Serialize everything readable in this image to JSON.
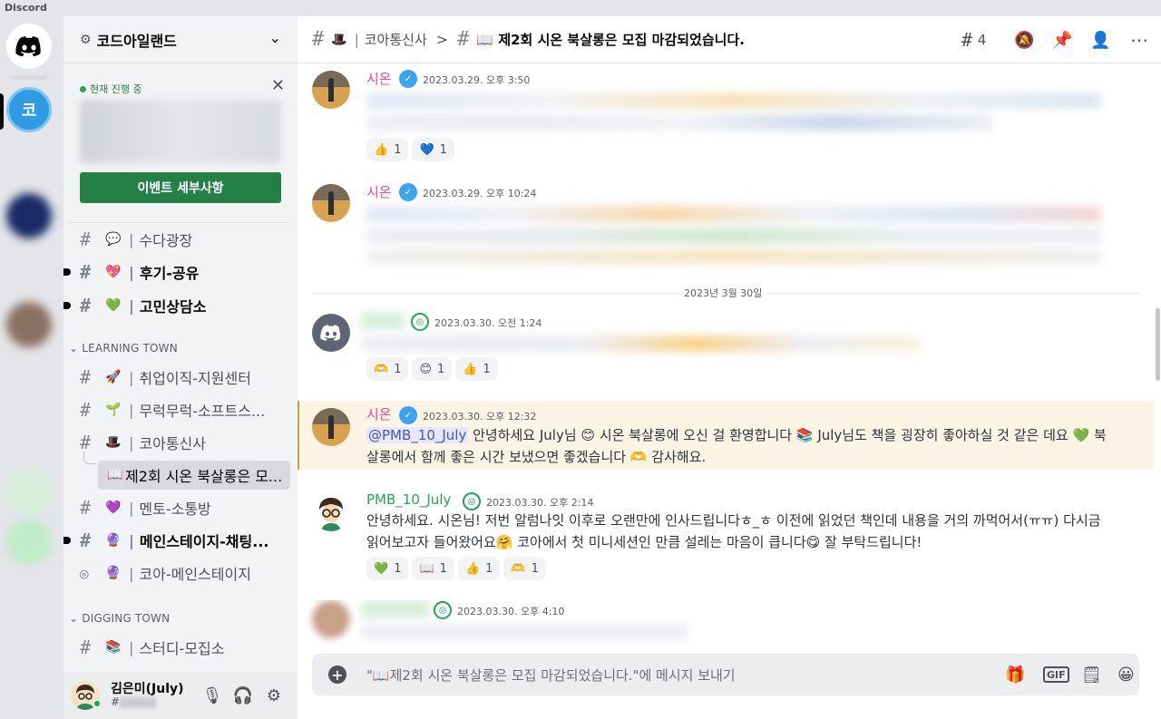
{
  "app": {
    "name": "Discord"
  },
  "server": {
    "name": "코드아일랜드"
  },
  "event": {
    "live_label": "현재 진행 중",
    "button_label": "이벤트 세부사항"
  },
  "channels": [
    {
      "emoji": "💬",
      "label": "수다광장"
    },
    {
      "emoji": "💖",
      "label": "후기-공유"
    },
    {
      "emoji": "💚",
      "label": "고민상담소"
    }
  ],
  "category_learning": "LEARNING TOWN",
  "learning": [
    {
      "emoji": "🚀",
      "label": "취업이직-지원센터"
    },
    {
      "emoji": "🌱",
      "label": "무럭무럭-소프트스..."
    },
    {
      "emoji": "🎩",
      "label": "코아통신사"
    },
    {
      "emoji": "📖",
      "label": "제2회 시온 북살롱은 모..."
    },
    {
      "emoji": "💜",
      "label": "멘토-소통방"
    },
    {
      "emoji": "🔮",
      "label": "메인스테이지-채팅..."
    },
    {
      "emoji": "🔮",
      "label": "코아-메인스테이지"
    }
  ],
  "category_digging": "DIGGING TOWN",
  "digging": [
    {
      "emoji": "📚",
      "label": "스터디-모집소"
    }
  ],
  "user": {
    "name": "김은미(July)",
    "tag": "#"
  },
  "topbar": {
    "channel": "코아통신사",
    "separator": ">",
    "thread": "📖 제2회 시온 북살롱은 모집 마감되었습니다.",
    "thread_count": "4"
  },
  "messages": [
    {
      "author": "시온",
      "timestamp": "2023.03.29. 오후 3:50",
      "reactions": [
        {
          "emoji": "👍",
          "count": "1"
        },
        {
          "emoji": "💙",
          "count": "1"
        }
      ]
    },
    {
      "author": "시온",
      "timestamp": "2023.03.29. 오후 10:24"
    },
    {
      "author": "",
      "timestamp": "2023.03.30. 오전 1:24",
      "reactions": [
        {
          "emoji": "🫶",
          "count": "1"
        },
        {
          "emoji": "😊",
          "count": "1"
        },
        {
          "emoji": "👍",
          "count": "1"
        }
      ]
    },
    {
      "author": "시온",
      "timestamp": "2023.03.30. 오후 12:32",
      "mention": "@PMB_10_July",
      "text_1": " 안녕하세요 July님 😊 시온 북살롱에 오신 걸 환영합니다 📚 July님도 책을 굉장히 좋아하실 것 같은 데요 💚 북살롱에서 함께 좋은 시간 보냈으면 좋겠습니다 🫶 감사해요."
    },
    {
      "author": "PMB_10_July",
      "timestamp": "2023.03.30. 오후 2:14",
      "text": "안녕하세요. 시온님! 저번 알럼나잇 이후로 오랜만에 인사드립니다ㅎ_ㅎ 이전에 읽었던 책인데 내용을 거의 까먹어서(ㅠㅠ) 다시금 읽어보고자 들어왔어요🤗 코아에서 첫 미니세션인 만큼 설레는 마음이 큽니다😋 잘 부탁드립니다!",
      "reactions": [
        {
          "emoji": "💚",
          "count": "1"
        },
        {
          "emoji": "📖",
          "count": "1"
        },
        {
          "emoji": "👍",
          "count": "1"
        },
        {
          "emoji": "🫶",
          "count": "1"
        }
      ]
    },
    {
      "author": "",
      "timestamp": "2023.03.30. 오후 4:10"
    }
  ],
  "date_divider": "2023년 3월 30일",
  "composer": {
    "placeholder": "\"📖제2회 시온 북살롱은 모집 마감되었습니다.\"에 메시지 보내기",
    "gif_label": "GIF"
  },
  "colors": {
    "accent_pink": "#eb459e",
    "accent_green": "#23a55a",
    "brand": "#5865f2"
  }
}
